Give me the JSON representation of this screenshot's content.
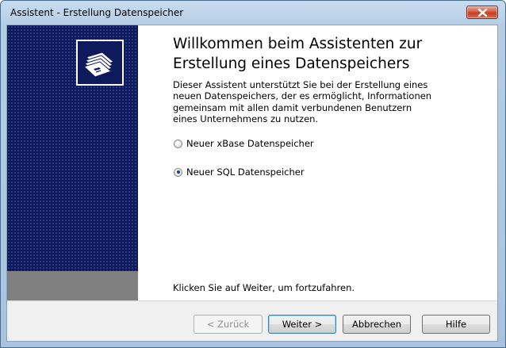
{
  "window": {
    "title": "Assistent - Erstellung Datenspeicher",
    "close_icon": "close-icon"
  },
  "side_panel": {
    "logo_icon": "database-cards-icon",
    "colors": {
      "panel": "#0e1a5c",
      "footer": "#808080"
    }
  },
  "main": {
    "heading_line1": "Willkommen beim Assistenten zur",
    "heading_line2": "Erstellung eines Datenspeichers",
    "description": "Dieser Assistent unterstützt Sie bei der Erstellung eines neuen Datenspeichers, der es ermöglicht, Informationen gemeinsam mit allen damit verbundenen Benutzern eines Unternehmens zu nutzen.",
    "options": [
      {
        "label": "Neuer xBase Datenspeicher",
        "checked": false
      },
      {
        "label": "Neuer SQL Datenspeicher",
        "checked": true
      }
    ],
    "hint": "Klicken Sie auf Weiter, um fortzufahren."
  },
  "buttons": {
    "back": "< Zurück",
    "next": "Weiter >",
    "cancel": "Abbrechen",
    "help": "Hilfe"
  }
}
